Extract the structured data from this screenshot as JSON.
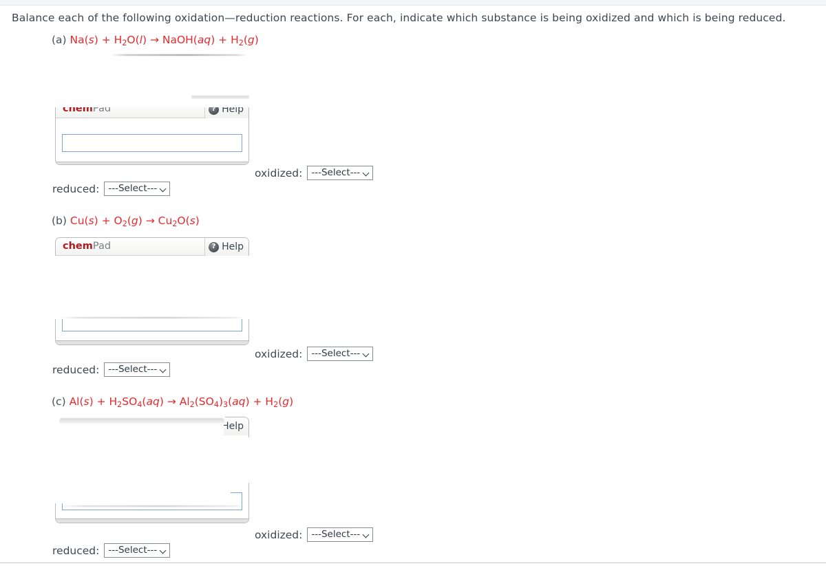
{
  "prompt": "Balance each of the following oxidation—reduction reactions. For each, indicate which substance is being oxidized and which is being reduced.",
  "colors": {
    "equation_red": "#e8282c",
    "body_text": "#3c4650",
    "chempad_red": "#b01b20",
    "input_border_blue": "#7fa4cc",
    "footer_gray": "#e4e2e0"
  },
  "widget": {
    "brand_bold": "chem",
    "brand_light": "Pad",
    "help_label": "Help",
    "help_icon": "question-mark-icon",
    "input_value": "",
    "clipped_help_fragment": "elp"
  },
  "labels": {
    "oxidized": "oxidized:",
    "reduced": "reduced:",
    "select_placeholder": "---Select---",
    "chevron_icon": "chevron-down-icon"
  },
  "problems": [
    {
      "id": "a",
      "label": "(a)",
      "equation_text": "Na(s) + H2O(l) → NaOH(aq) + H2(g)",
      "reactants": [
        "Na(s)",
        "H2O(l)"
      ],
      "products": [
        "NaOH(aq)",
        "H2(g)"
      ],
      "oxidized_value": "---Select---",
      "reduced_value": "---Select---"
    },
    {
      "id": "b",
      "label": "(b)",
      "equation_text": "Cu(s) + O2(g) → Cu2O(s)",
      "reactants": [
        "Cu(s)",
        "O2(g)"
      ],
      "products": [
        "Cu2O(s)"
      ],
      "oxidized_value": "---Select---",
      "reduced_value": "---Select---"
    },
    {
      "id": "c",
      "label": "(c)",
      "equation_text": "Al(s) + H2SO4(aq) → Al2(SO4)3(aq) + H2(g)",
      "reactants": [
        "Al(s)",
        "H2SO4(aq)"
      ],
      "products": [
        "Al2(SO4)3(aq)",
        "H2(g)"
      ],
      "oxidized_value": "---Select---",
      "reduced_value": "---Select---"
    }
  ]
}
